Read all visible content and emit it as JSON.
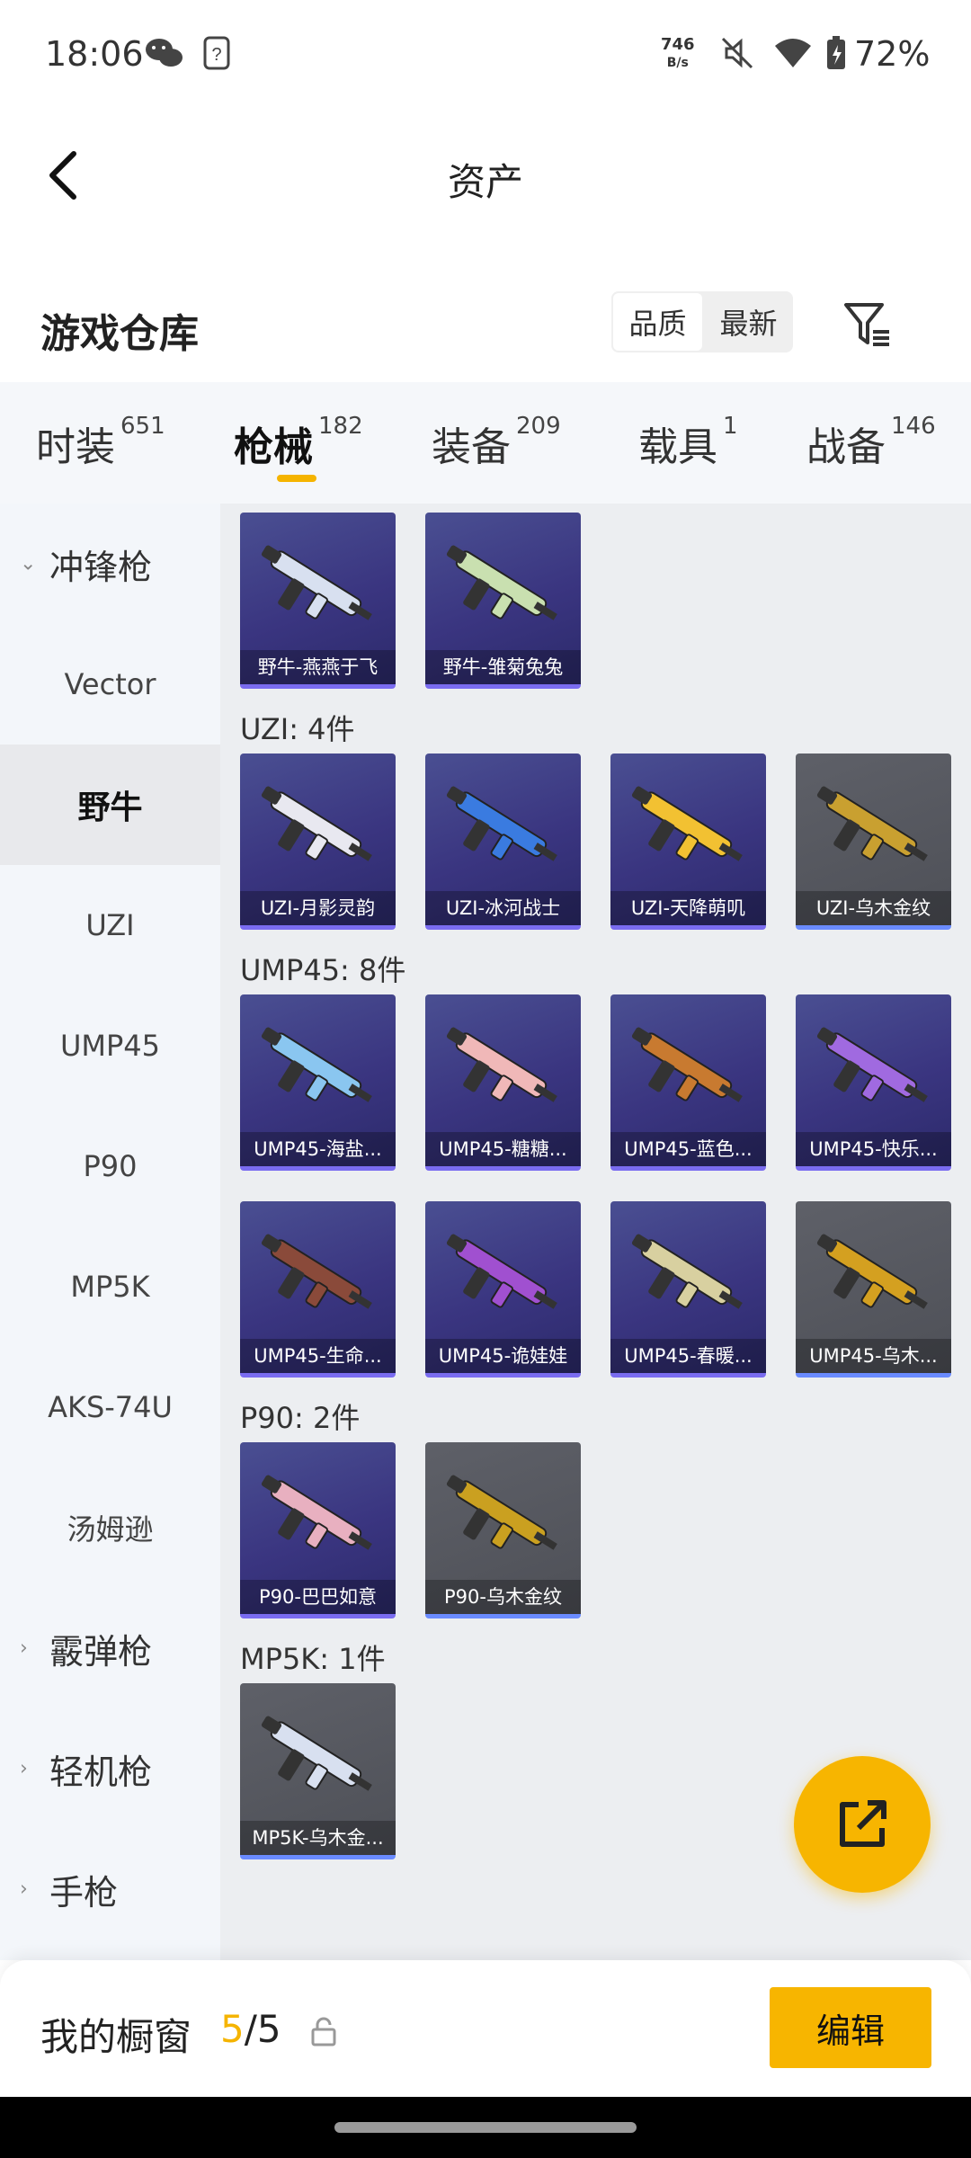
{
  "status_bar": {
    "time": "18:06",
    "net_speed": "746",
    "net_unit": "B/s",
    "battery": "72%"
  },
  "nav": {
    "title": "资产"
  },
  "section": {
    "title": "游戏仓库",
    "sort_options": [
      "品质",
      "最新"
    ],
    "sort_active": "品质"
  },
  "tabs": [
    {
      "label": "时装",
      "count": "651"
    },
    {
      "label": "枪械",
      "count": "182"
    },
    {
      "label": "装备",
      "count": "209"
    },
    {
      "label": "载具",
      "count": "1"
    },
    {
      "label": "战备",
      "count": "146"
    }
  ],
  "sidebar": {
    "items": [
      {
        "label": "冲锋枪",
        "type": "group",
        "expanded": true
      },
      {
        "label": "Vector",
        "type": "item"
      },
      {
        "label": "野牛",
        "type": "item",
        "selected": true
      },
      {
        "label": "UZI",
        "type": "item"
      },
      {
        "label": "UMP45",
        "type": "item"
      },
      {
        "label": "P90",
        "type": "item"
      },
      {
        "label": "MP5K",
        "type": "item"
      },
      {
        "label": "AKS-74U",
        "type": "item"
      },
      {
        "label": "汤姆逊",
        "type": "item"
      },
      {
        "label": "霰弹枪",
        "type": "group",
        "expanded": false
      },
      {
        "label": "轻机枪",
        "type": "group",
        "expanded": false
      },
      {
        "label": "手枪",
        "type": "group",
        "expanded": false
      }
    ]
  },
  "content": {
    "groups": [
      {
        "label": "",
        "items": [
          {
            "name": "野牛-燕燕于飞",
            "rarity": "purple"
          },
          {
            "name": "野牛-雏菊兔兔",
            "rarity": "purple"
          }
        ]
      },
      {
        "label": "UZI: 4件",
        "items": [
          {
            "name": "UZI-月影灵韵",
            "rarity": "purple"
          },
          {
            "name": "UZI-冰河战士",
            "rarity": "purple"
          },
          {
            "name": "UZI-天降萌叽",
            "rarity": "purple"
          },
          {
            "name": "UZI-乌木金纹",
            "rarity": "gray"
          }
        ]
      },
      {
        "label": "UMP45: 8件",
        "items": [
          {
            "name": "UMP45-海盐...",
            "rarity": "purple"
          },
          {
            "name": "UMP45-糖糖...",
            "rarity": "purple"
          },
          {
            "name": "UMP45-蓝色...",
            "rarity": "purple"
          },
          {
            "name": "UMP45-快乐...",
            "rarity": "purple"
          },
          {
            "name": "UMP45-生命...",
            "rarity": "purple"
          },
          {
            "name": "UMP45-诡娃娃",
            "rarity": "purple"
          },
          {
            "name": "UMP45-春暖...",
            "rarity": "purple"
          },
          {
            "name": "UMP45-乌木...",
            "rarity": "gray"
          }
        ]
      },
      {
        "label": "P90: 2件",
        "items": [
          {
            "name": "P90-巴巴如意",
            "rarity": "purple"
          },
          {
            "name": "P90-乌木金纹",
            "rarity": "gray"
          }
        ]
      },
      {
        "label": "MP5K: 1件",
        "items": [
          {
            "name": "MP5K-乌木金...",
            "rarity": "gray"
          }
        ]
      }
    ]
  },
  "bottom": {
    "window_label": "我的橱窗",
    "window_current": "5",
    "window_total": "5",
    "edit_label": "编辑"
  },
  "colors": {
    "accent": "#f7b500",
    "card_purple": "#3a3580",
    "card_gray": "#55575e"
  }
}
